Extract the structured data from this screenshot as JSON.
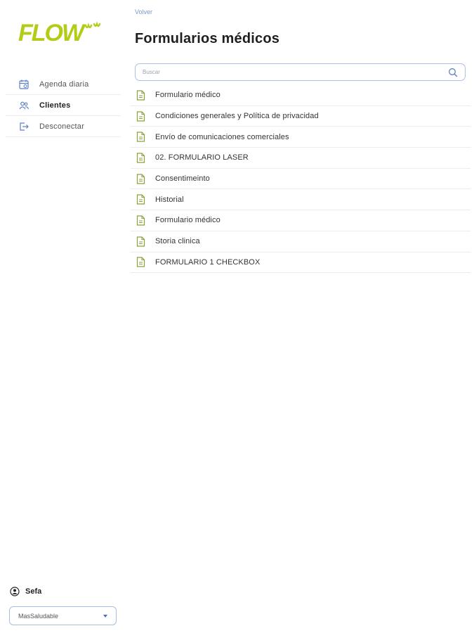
{
  "brand": {
    "logo_text": "FLOW",
    "color": "#b4cc18"
  },
  "sidebar": {
    "items": [
      {
        "label": "Agenda diaria",
        "icon": "calendar-icon"
      },
      {
        "label": "Clientes",
        "icon": "users-icon",
        "active": true
      },
      {
        "label": "Desconectar",
        "icon": "logout-icon"
      }
    ],
    "user": {
      "name": "Sefa",
      "icon": "user-circle-icon"
    },
    "center_select": {
      "value": "MasSaludable"
    }
  },
  "main": {
    "back_label": "Volver",
    "title": "Formularios médicos",
    "search": {
      "placeholder": "Buscar",
      "icon": "search-icon"
    },
    "forms": [
      "Formulario médico",
      "Condiciones generales y Política de privacidad",
      "Envío de comunicaciones comerciales",
      "02. FORMULARIO LASER",
      "Consentimeinto",
      "Historial",
      "Formulario médico",
      "Storia clinica",
      "FORMULARIO 1 CHECKBOX"
    ],
    "form_icon": "document-icon"
  },
  "colors": {
    "accent": "#6b8fd0",
    "icon_green": "#8aa03a",
    "border": "#aac1e6"
  }
}
